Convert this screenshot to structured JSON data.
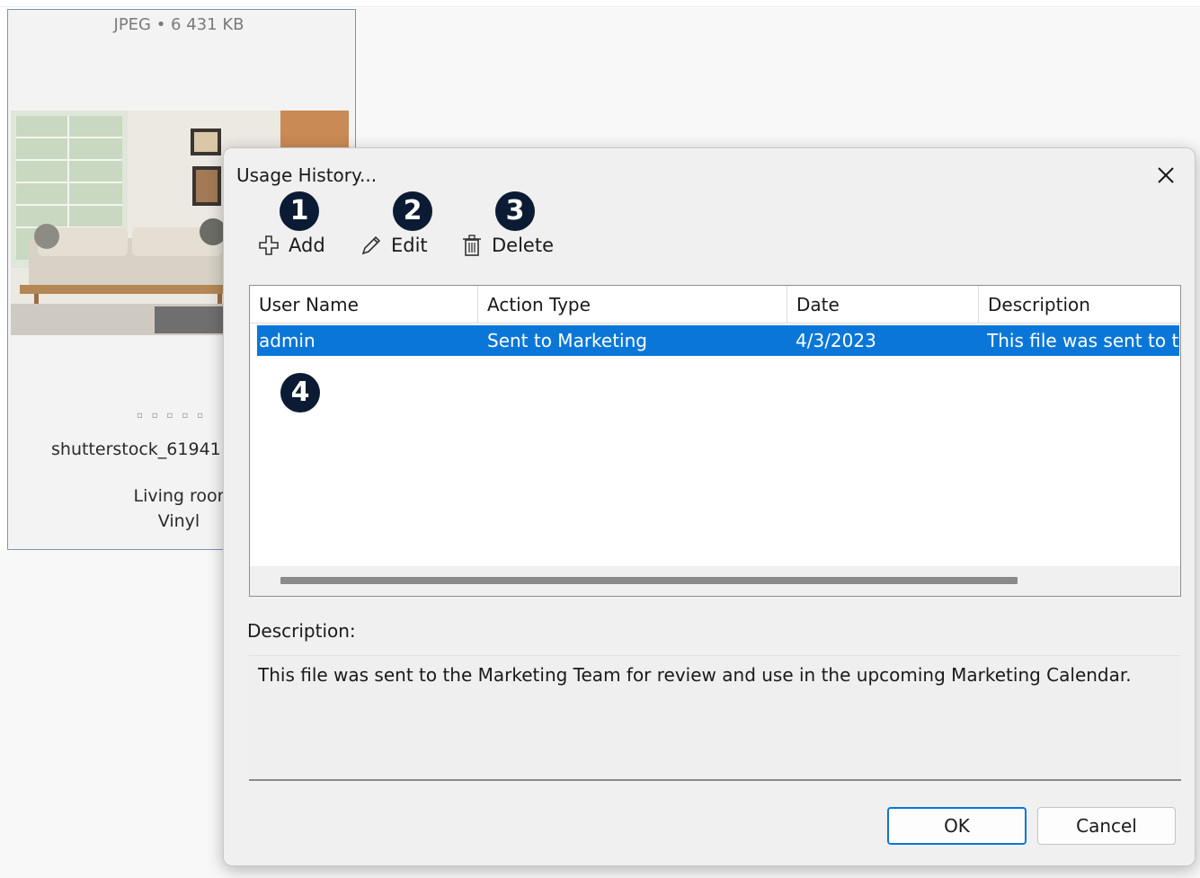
{
  "background_card": {
    "meta": "JPEG • 6 431 KB",
    "filename": "shutterstock_61941",
    "line1": "Living roor",
    "line2": "Vinyl"
  },
  "dialog": {
    "title": "Usage History...",
    "toolbar": {
      "add_label": "Add",
      "edit_label": "Edit",
      "delete_label": "Delete"
    },
    "callouts": [
      "1",
      "2",
      "3",
      "4"
    ],
    "grid": {
      "columns": [
        "User Name",
        "Action Type",
        "Date",
        "Description"
      ],
      "rows": [
        {
          "user_name": "admin",
          "action_type": "Sent to Marketing",
          "date": "4/3/2023",
          "description": "This file was sent to t"
        }
      ]
    },
    "description_label": "Description:",
    "description_text": "This file was sent to the Marketing Team for review and use in the upcoming Marketing Calendar.",
    "ok_label": "OK",
    "cancel_label": "Cancel"
  },
  "icons": {
    "close": "close-icon",
    "add": "plus-icon",
    "edit": "pencil-icon",
    "delete": "trash-icon"
  },
  "colors": {
    "selection": "#0a77d8",
    "callout": "#0b1b33",
    "dialog_bg": "#f0f0f0"
  }
}
